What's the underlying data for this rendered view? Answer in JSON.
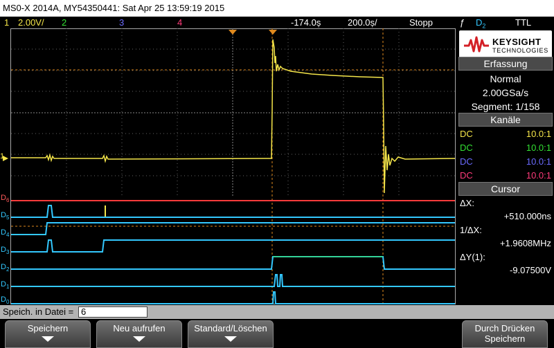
{
  "titlebar": {
    "text": "MS0-X 2014A, MY54350441: Sat Apr 25 13:59:19 2015"
  },
  "channels": {
    "ch1": {
      "num": "1",
      "scale": "2.00V/",
      "color": "#f5e64a"
    },
    "ch2": {
      "num": "2",
      "color": "#33e033"
    },
    "ch3": {
      "num": "3",
      "color": "#6b6bff"
    },
    "ch4": {
      "num": "4",
      "color": "#ff3b7a"
    },
    "offset": "-174.0ș",
    "timebase": "200.0ș/",
    "run_state": "Stopp",
    "trigger": {
      "edge_symbol": "ƒ",
      "source": "D",
      "source_sub": "2",
      "mode": "TTL"
    }
  },
  "scope": {
    "ground_marker": "1",
    "digital_labels": [
      {
        "label": "D",
        "sub": "6"
      },
      {
        "label": "D",
        "sub": "5"
      },
      {
        "label": "D",
        "sub": "4"
      },
      {
        "label": "D",
        "sub": "3"
      },
      {
        "label": "D",
        "sub": "2"
      },
      {
        "label": "D",
        "sub": "1"
      },
      {
        "label": "D",
        "sub": "0"
      }
    ]
  },
  "panel": {
    "brand_name": "KEYSIGHT",
    "brand_sub": "TECHNOLOGIES",
    "acquisition": {
      "header": "Erfassung",
      "mode": "Normal",
      "rate": "2.00GSa/s",
      "segment": "Segment: 1/158"
    },
    "channels": {
      "header": "Kanäle",
      "rows": [
        {
          "coupling": "DC",
          "ratio": "10.0:1",
          "color": "#f5e64a"
        },
        {
          "coupling": "DC",
          "ratio": "10.0:1",
          "color": "#33e033"
        },
        {
          "coupling": "DC",
          "ratio": "10.0:1",
          "color": "#6b6bff"
        },
        {
          "coupling": "DC",
          "ratio": "10.0:1",
          "color": "#ff3b7a"
        }
      ]
    },
    "cursor": {
      "header": "Cursor",
      "dx_label": "ΔX:",
      "dx_value": "+510.000ns",
      "inv_dx_label": "1/ΔX:",
      "inv_dx_value": "+1.9608MHz",
      "dy_label": "ΔY(1):",
      "dy_value": "-9.07500V"
    }
  },
  "save_row": {
    "label": "Speich. in Datei =",
    "value": "6"
  },
  "softkeys": [
    {
      "line1": "Speichern",
      "line2": ""
    },
    {
      "line1": "Neu aufrufen",
      "line2": ""
    },
    {
      "line1": "Standard/Löschen",
      "line2": ""
    },
    {
      "line1": "Durch Drücken",
      "line2": "Speichern"
    }
  ]
}
